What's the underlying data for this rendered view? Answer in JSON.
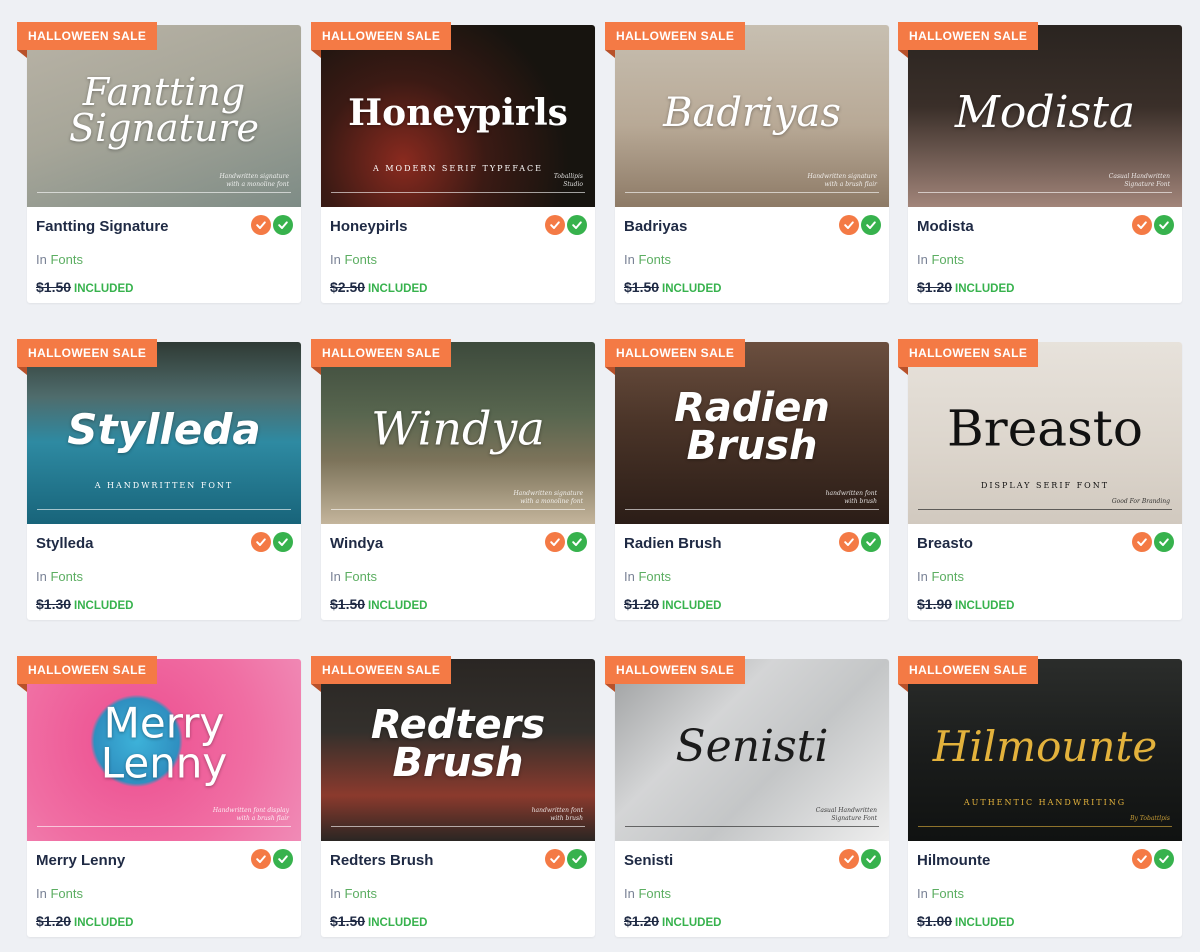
{
  "colors": {
    "badge": "#f47a45",
    "included": "#37b24d",
    "category_link": "#5cae62",
    "old_price": "#1f2a44"
  },
  "products": [
    {
      "badge": "HALLOWEEN SALE",
      "name": "Fantting Signature",
      "category_prefix": "In",
      "category": "Fonts",
      "old_price": "$1.50",
      "status": "INCLUDED",
      "icons": [
        "discount-icon",
        "check-icon"
      ],
      "thumb": {
        "bg": "linear-gradient(160deg,#b9b3a6 0%,#a7a699 45%,#7e8c86 100%)",
        "title": "Fantting\nSignature",
        "font": "\"DejaVu Serif\", serif",
        "style": "italic",
        "weight": "400",
        "size": 38,
        "color": "#ffffff",
        "sub": "",
        "note": "Handwritten signature\nwith a monoline font"
      }
    },
    {
      "badge": "HALLOWEEN SALE",
      "name": "Honeypirls",
      "category_prefix": "In",
      "category": "Fonts",
      "old_price": "$2.50",
      "status": "INCLUDED",
      "icons": [
        "discount-icon",
        "check-icon"
      ],
      "thumb": {
        "bg": "radial-gradient(circle at 30% 75%,#8a2a1f 0%,#3b1a14 35%,#17140f 70%)",
        "title": "Honeypirls",
        "font": "\"DejaVu Serif\", serif",
        "style": "normal",
        "weight": "700",
        "size": 36,
        "color": "#ffffff",
        "sub": "A MODERN SERIF TYPEFACE",
        "note": "Toballipis\nStudio"
      }
    },
    {
      "badge": "HALLOWEEN SALE",
      "name": "Badriyas",
      "category_prefix": "In",
      "category": "Fonts",
      "old_price": "$1.50",
      "status": "INCLUDED",
      "icons": [
        "discount-icon",
        "check-icon"
      ],
      "thumb": {
        "bg": "linear-gradient(180deg,#c7bfb1 0%,#b8a996 55%,#8d7a66 100%)",
        "title": "Badriyas",
        "font": "\"DejaVu Serif\", serif",
        "style": "italic",
        "weight": "400",
        "size": 40,
        "color": "#ffffff",
        "sub": "",
        "note": "Handwritten signature\nwith a brush flair"
      }
    },
    {
      "badge": "HALLOWEEN SALE",
      "name": "Modista",
      "category_prefix": "In",
      "category": "Fonts",
      "old_price": "$1.20",
      "status": "INCLUDED",
      "icons": [
        "discount-icon",
        "check-icon"
      ],
      "thumb": {
        "bg": "linear-gradient(180deg,#2a2420 0%,#3a2f29 45%,#a2857a 100%)",
        "title": "Modista",
        "font": "\"DejaVu Serif\", serif",
        "style": "italic",
        "weight": "400",
        "size": 44,
        "color": "#ffffff",
        "sub": "",
        "note": "Casual Handwritten\nSignature Font"
      }
    },
    {
      "badge": "HALLOWEEN SALE",
      "name": "Stylleda",
      "category_prefix": "In",
      "category": "Fonts",
      "old_price": "$1.30",
      "status": "INCLUDED",
      "icons": [
        "discount-icon",
        "check-icon"
      ],
      "thumb": {
        "bg": "linear-gradient(180deg,#2f3a34 0%,#4f6c6c 30%,#2e8aa2 55%,#18647a 100%)",
        "title": "Stylleda",
        "font": "\"DejaVu Sans\", sans-serif",
        "style": "italic",
        "weight": "700",
        "size": 42,
        "color": "#ffffff",
        "sub": "A HANDWRITTEN FONT",
        "note": ""
      }
    },
    {
      "badge": "HALLOWEEN SALE",
      "name": "Windya",
      "category_prefix": "In",
      "category": "Fonts",
      "old_price": "$1.50",
      "status": "INCLUDED",
      "icons": [
        "discount-icon",
        "check-icon"
      ],
      "thumb": {
        "bg": "linear-gradient(180deg,#3d4a3c 0%,#58664f 40%,#7c735a 65%,#c4b59c 100%)",
        "title": "Windya",
        "font": "\"DejaVu Serif\", serif",
        "style": "italic",
        "weight": "400",
        "size": 46,
        "color": "#ffffff",
        "sub": "",
        "note": "Handwritten signature\nwith a monoline font"
      }
    },
    {
      "badge": "HALLOWEEN SALE",
      "name": "Radien Brush",
      "category_prefix": "In",
      "category": "Fonts",
      "old_price": "$1.20",
      "status": "INCLUDED",
      "icons": [
        "discount-icon",
        "check-icon"
      ],
      "thumb": {
        "bg": "linear-gradient(180deg,#6b4f3f 0%,#4a3428 45%,#2b1d17 100%)",
        "title": "Radien\nBrush",
        "font": "\"DejaVu Sans\", sans-serif",
        "style": "italic",
        "weight": "700",
        "size": 40,
        "color": "#ffffff",
        "sub": "",
        "note": "handwritten font\nwith brush"
      }
    },
    {
      "badge": "HALLOWEEN SALE",
      "name": "Breasto",
      "category_prefix": "In",
      "category": "Fonts",
      "old_price": "$1.90",
      "status": "INCLUDED",
      "icons": [
        "discount-icon",
        "check-icon"
      ],
      "thumb": {
        "bg": "linear-gradient(180deg,#e7e2db 0%,#dcd5cc 60%,#d1c9bf 100%)",
        "title": "Breasto",
        "font": "\"DejaVu Serif\", serif",
        "style": "normal",
        "weight": "400",
        "size": 50,
        "color": "#111111",
        "sub": "DISPLAY SERIF FONT",
        "note": "Good For Branding"
      }
    },
    {
      "badge": "HALLOWEEN SALE",
      "name": "Merry Lenny",
      "category_prefix": "In",
      "category": "Fonts",
      "old_price": "$1.20",
      "status": "INCLUDED",
      "icons": [
        "discount-icon",
        "check-icon"
      ],
      "thumb": {
        "bg": "radial-gradient(circle at 40% 45%,#3db2d9 0%,#2f8fc0 22%,#ee5a97 24%,#f06ea3 60%,#f08bb6 100%)",
        "title": "Merry\nLenny",
        "font": "\"DejaVu Sans\", sans-serif",
        "style": "normal",
        "weight": "400",
        "size": 42,
        "color": "#ffffff",
        "sub": "",
        "note": "Handwritten font display\nwith a brush flair"
      }
    },
    {
      "badge": "HALLOWEEN SALE",
      "name": "Redters Brush",
      "category_prefix": "In",
      "category": "Fonts",
      "old_price": "$1.50",
      "status": "INCLUDED",
      "icons": [
        "discount-icon",
        "check-icon"
      ],
      "thumb": {
        "bg": "linear-gradient(180deg,#2a2623 0%,#33302c 40%,#8b3a2d 75%,#2a2623 100%)",
        "title": "Redters\nBrush",
        "font": "\"DejaVu Sans\", sans-serif",
        "style": "italic",
        "weight": "700",
        "size": 40,
        "color": "#ffffff",
        "sub": "",
        "note": "handwritten font\nwith brush"
      }
    },
    {
      "badge": "HALLOWEEN SALE",
      "name": "Senisti",
      "category_prefix": "In",
      "category": "Fonts",
      "old_price": "$1.20",
      "status": "INCLUDED",
      "icons": [
        "discount-icon",
        "check-icon"
      ],
      "thumb": {
        "bg": "linear-gradient(135deg,#9c9e9f 0%,#d4d5d6 35%,#c4c6c7 60%,#eeeeee 100%)",
        "title": "Senisti",
        "font": "\"DejaVu Serif\", serif",
        "style": "italic",
        "weight": "400",
        "size": 44,
        "color": "#1b1b1b",
        "sub": "",
        "note": "Casual Handwritten\nSignature Font"
      }
    },
    {
      "badge": "HALLOWEEN SALE",
      "name": "Hilmounte",
      "category_prefix": "In",
      "category": "Fonts",
      "old_price": "$1.00",
      "status": "INCLUDED",
      "icons": [
        "discount-icon",
        "check-icon"
      ],
      "thumb": {
        "bg": "linear-gradient(180deg,#2b2d2b 0%,#1b1d1c 50%,#101211 100%)",
        "title": "Hilmounte",
        "font": "\"DejaVu Serif\", serif",
        "style": "italic",
        "weight": "400",
        "size": 42,
        "color": "#e3b23c",
        "sub": "AUTHENTIC HANDWRITING",
        "note": "By Tobattlpis"
      }
    }
  ]
}
